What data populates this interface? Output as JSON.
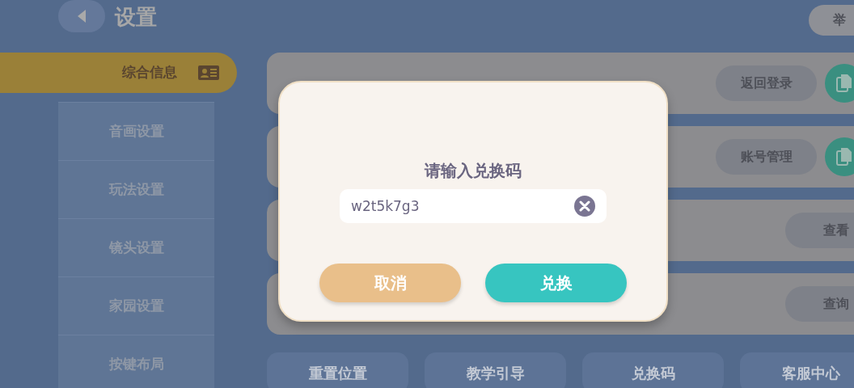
{
  "header": {
    "title": "设置",
    "report_button": "举"
  },
  "sidebar": {
    "items": [
      {
        "label": "综合信息",
        "selected": true
      },
      {
        "label": "音画设置",
        "selected": false
      },
      {
        "label": "玩法设置",
        "selected": false
      },
      {
        "label": "镜头设置",
        "selected": false
      },
      {
        "label": "家园设置",
        "selected": false
      },
      {
        "label": "按键布局",
        "selected": false
      }
    ]
  },
  "cards": [
    {
      "action": "返回登录",
      "has_copy": true
    },
    {
      "action": "账号管理",
      "has_copy": true
    },
    {
      "action": "查看",
      "has_copy": false
    },
    {
      "action": "查询",
      "has_copy": false
    }
  ],
  "bottom_buttons": [
    "重置位置",
    "教学引导",
    "兑换码",
    "客服中心"
  ],
  "dialog": {
    "title": "请输入兑换码",
    "input": {
      "value": "w2t5k7g3"
    },
    "buttons": [
      {
        "label": "取消",
        "kind": "cancel"
      },
      {
        "label": "兑换",
        "kind": "confirm"
      }
    ]
  }
}
